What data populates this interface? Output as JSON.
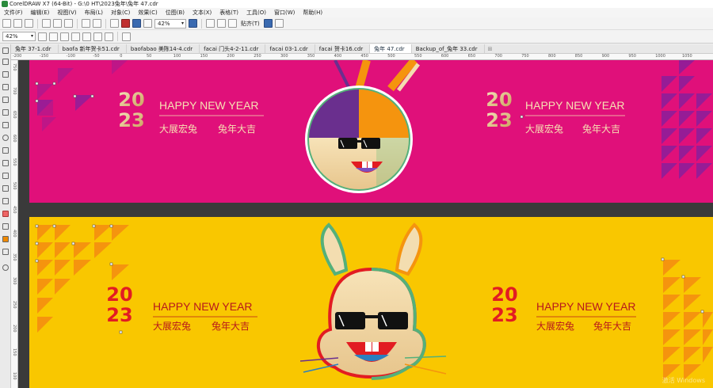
{
  "window": {
    "title": "CorelDRAW X7 (64-Bit) - G:\\0 HT\\2023兔年\\兔年 47.cdr"
  },
  "menu": [
    "文件(F)",
    "编辑(E)",
    "视图(V)",
    "布局(L)",
    "对象(C)",
    "效果(C)",
    "位图(B)",
    "文本(X)",
    "表格(T)",
    "工具(O)",
    "窗口(W)",
    "帮助(H)"
  ],
  "toolbar": {
    "zoom_top": "42%",
    "zoom_left": "42%",
    "snap_label": "贴齐(T)"
  },
  "tabs": [
    "兔年 37-1.cdr",
    "baofa 新年贺卡51.cdr",
    "baofabao 美陈14-4.cdr",
    "facai 门头4-2-11.cdr",
    "facai 03-1.cdr",
    "facai 贺卡16.cdr",
    "兔年 47.cdr",
    "Backup_of_兔年 33.cdr"
  ],
  "active_tab_index": 6,
  "ruler_h": [
    "-200",
    "-150",
    "-100",
    "-50",
    "0",
    "50",
    "100",
    "150",
    "200",
    "250",
    "300",
    "350",
    "400",
    "450",
    "500",
    "550",
    "600",
    "650",
    "700",
    "750",
    "800",
    "850",
    "900",
    "950",
    "1000",
    "1050"
  ],
  "ruler_v": [
    "750",
    "700",
    "650",
    "600",
    "550",
    "500",
    "450",
    "400",
    "350",
    "300",
    "250",
    "200",
    "150",
    "100"
  ],
  "artwork": {
    "year_top": "20",
    "year_bottom": "23",
    "greeting": "HAPPY NEW YEAR",
    "chinese_left": "大展宏兔",
    "chinese_right": "兔年大吉",
    "colors": {
      "magenta": "#e0107a",
      "yellow": "#f9c700",
      "purple": "#6a2f8e",
      "orange": "#f5940e",
      "red": "#e21c22",
      "gold": "#e9c98e",
      "cream": "#f3ddb0"
    }
  },
  "watermark": "激活 Windows"
}
